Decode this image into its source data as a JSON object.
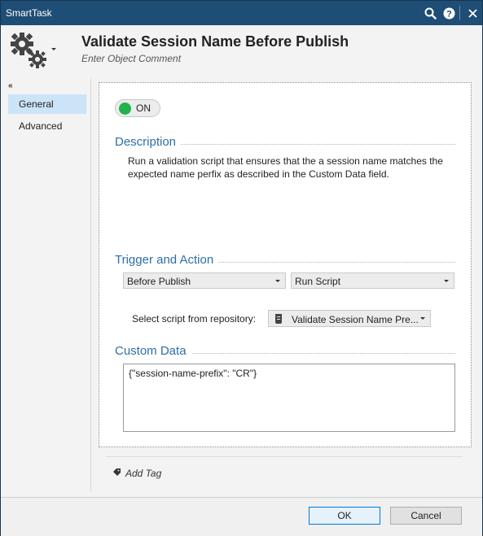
{
  "window": {
    "title": "SmartTask"
  },
  "titlebar_icons": {
    "search": "search-icon",
    "help": "help-icon",
    "close": "close-icon"
  },
  "header": {
    "title": "Validate Session Name Before Publish",
    "comment_placeholder": "Enter Object Comment",
    "icon": "gears-icon"
  },
  "nav": {
    "collapse_glyph": "«",
    "items": [
      {
        "label": "General",
        "active": true
      },
      {
        "label": "Advanced",
        "active": false
      }
    ]
  },
  "toggle": {
    "state_label": "ON",
    "enabled": true,
    "color": "#22b24c"
  },
  "description": {
    "heading": "Description",
    "text": "Run a validation script that ensures that the a session name matches the expected name perfix as described in the Custom Data field."
  },
  "trigger": {
    "heading": "Trigger and Action",
    "trigger_value": "Before Publish",
    "action_value": "Run Script",
    "repository_label": "Select script from repository:",
    "script_value": "Validate Session Name Pre..."
  },
  "custom_data": {
    "heading": "Custom Data",
    "value": "{\"session-name-prefix\": \"CR\"}"
  },
  "tags": {
    "add_label": "Add Tag"
  },
  "footer": {
    "ok_label": "OK",
    "cancel_label": "Cancel"
  },
  "colors": {
    "titlebar": "#1e4d75",
    "accent": "#2e6ea8",
    "nav_active": "#cce4f7"
  }
}
